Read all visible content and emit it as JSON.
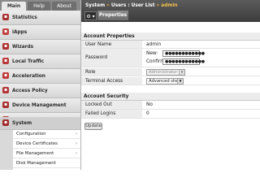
{
  "sidebar": {
    "tabs": [
      {
        "label": "Main"
      },
      {
        "label": "Help"
      },
      {
        "label": "About"
      }
    ],
    "items": [
      {
        "label": "Statistics",
        "icon": "statistics-icon",
        "color": "#a83232"
      },
      {
        "label": "iApps",
        "icon": "iapps-icon",
        "color": "#c04040"
      },
      {
        "label": "Wizards",
        "icon": "wizards-icon",
        "color": "#b03030"
      },
      {
        "label": "Local Traffic",
        "icon": "local-traffic-icon",
        "color": "#b83a3a"
      },
      {
        "label": "Acceleration",
        "icon": "acceleration-icon",
        "color": "#c03838"
      },
      {
        "label": "Access Policy",
        "icon": "access-policy-icon",
        "color": "#b23434"
      },
      {
        "label": "Device Management",
        "icon": "device-management-icon",
        "color": "#a83030"
      },
      {
        "label": "Network",
        "icon": "network-icon",
        "color": "#b83636"
      },
      {
        "label": "System",
        "icon": "system-icon",
        "color": "#a02c2c"
      }
    ],
    "submenu": [
      {
        "label": "Configuration",
        "arrow": "›"
      },
      {
        "label": "Device Certificates",
        "arrow": "›"
      },
      {
        "label": "File Management",
        "arrow": "›"
      },
      {
        "label": "Disk Management",
        "arrow": ""
      }
    ]
  },
  "header": {
    "crumb1": "System",
    "crumb2": "Users : User List",
    "crumb3": "admin",
    "separator": "»",
    "menu_glyph": "⚙ ▾",
    "tab": "Properties"
  },
  "account_properties": {
    "title": "Account Properties",
    "user_name_label": "User Name",
    "user_name_value": "admin",
    "password_label": "Password",
    "new_label": "New:",
    "confirm_label": "Confirm:",
    "password_mask": "●●●●●●●●●●●●",
    "confirm_mask": "●●●●●●●●●●●●",
    "role_label": "Role",
    "role_value": "Administrator",
    "terminal_label": "Terminal Access",
    "terminal_value": "Advanced shell"
  },
  "account_security": {
    "title": "Account Security",
    "locked_out_label": "Locked Out",
    "locked_out_value": "No",
    "failed_logins_label": "Failed Logins",
    "failed_logins_value": "0"
  },
  "actions": {
    "update_label": "Update"
  },
  "colors": {
    "accent": "#f1c04f",
    "header_bg": "#4a4a4a",
    "sidebar_bg": "#d9d9d9"
  }
}
